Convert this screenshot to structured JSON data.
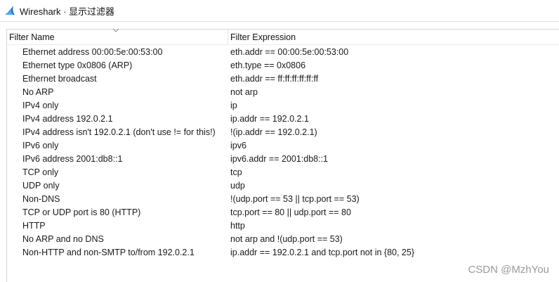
{
  "window": {
    "title": "Wireshark · 显示过滤器"
  },
  "table": {
    "columns": [
      "Filter Name",
      "Filter Expression"
    ],
    "rows": [
      {
        "name": "Ethernet address 00:00:5e:00:53:00",
        "expr": "eth.addr == 00:00:5e:00:53:00"
      },
      {
        "name": "Ethernet type 0x0806 (ARP)",
        "expr": "eth.type == 0x0806"
      },
      {
        "name": "Ethernet broadcast",
        "expr": "eth.addr == ff:ff:ff:ff:ff:ff"
      },
      {
        "name": "No ARP",
        "expr": "not arp"
      },
      {
        "name": "IPv4 only",
        "expr": "ip"
      },
      {
        "name": "IPv4 address 192.0.2.1",
        "expr": "ip.addr == 192.0.2.1"
      },
      {
        "name": "IPv4 address isn't 192.0.2.1 (don't use != for this!)",
        "expr": "!(ip.addr == 192.0.2.1)"
      },
      {
        "name": "IPv6 only",
        "expr": "ipv6"
      },
      {
        "name": "IPv6 address 2001:db8::1",
        "expr": "ipv6.addr == 2001:db8::1"
      },
      {
        "name": "TCP only",
        "expr": "tcp"
      },
      {
        "name": "UDP only",
        "expr": "udp"
      },
      {
        "name": "Non-DNS",
        "expr": "!(udp.port == 53 || tcp.port == 53)"
      },
      {
        "name": "TCP or UDP port is 80 (HTTP)",
        "expr": "tcp.port == 80 || udp.port == 80"
      },
      {
        "name": "HTTP",
        "expr": "http"
      },
      {
        "name": "No ARP and no DNS",
        "expr": "not arp and !(udp.port == 53)"
      },
      {
        "name": "Non-HTTP and non-SMTP to/from 192.0.2.1",
        "expr": "ip.addr == 192.0.2.1 and tcp.port not in {80, 25}"
      }
    ]
  },
  "watermark": "CSDN @MzhYou",
  "colors": {
    "icon_fin": "#1679c8",
    "watermark": "#9a9a9a"
  },
  "icons": {
    "app": "wireshark-fin-icon",
    "sort": "sort-chevron-icon"
  }
}
